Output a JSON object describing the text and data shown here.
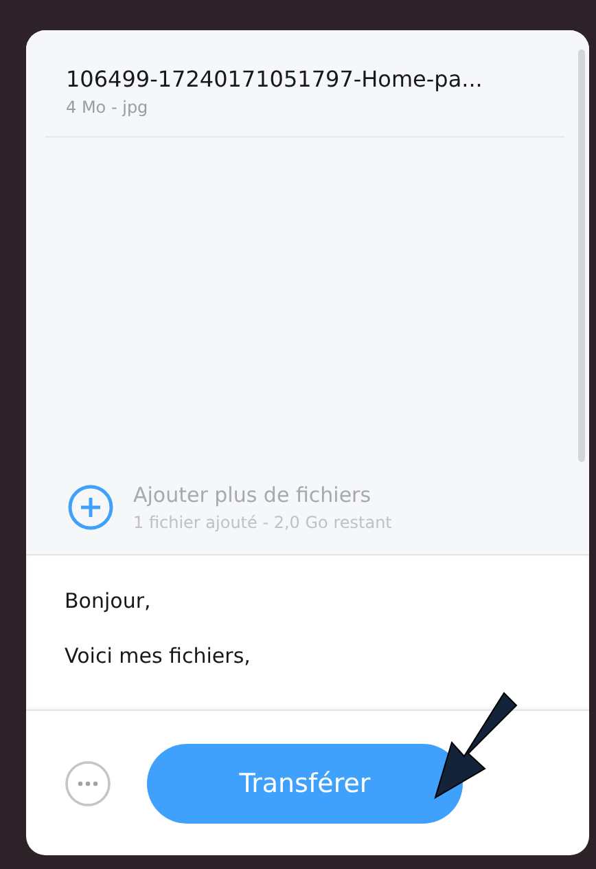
{
  "files": [
    {
      "name": "106499-17240171051797-Home-pa...",
      "meta": "4 Mo - jpg"
    }
  ],
  "add_files": {
    "label": "Ajouter plus de fichiers",
    "info": "1 fichier ajouté - 2,0 Go restant"
  },
  "message": [
    "Bonjour,",
    "Voici mes fichiers,"
  ],
  "footer": {
    "button": "Transférer"
  }
}
